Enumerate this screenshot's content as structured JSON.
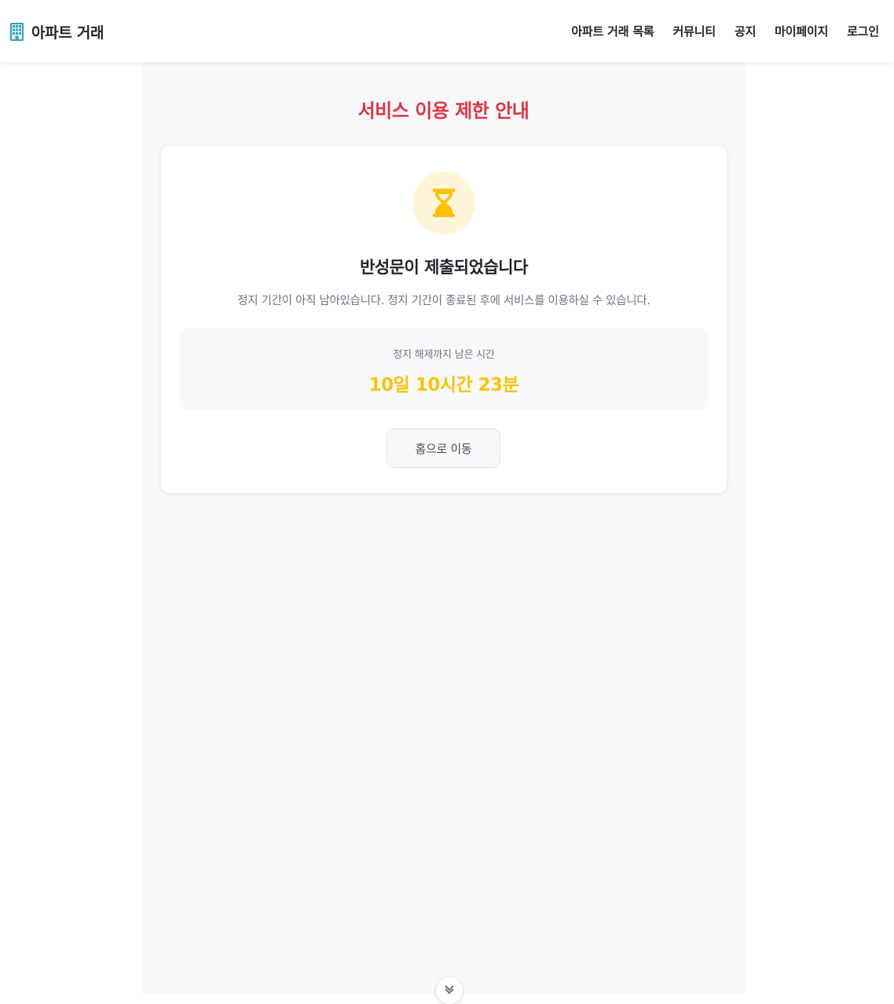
{
  "header": {
    "brand_icon": "office-building-icon",
    "brand_text": "아파트 거래",
    "nav_items": [
      {
        "label": "아파트 거래 목록"
      },
      {
        "label": "커뮤니티"
      },
      {
        "label": "공지"
      },
      {
        "label": "마이페이지"
      },
      {
        "label": "로그인"
      }
    ]
  },
  "main": {
    "title": "서비스 이용 제한 안내",
    "card": {
      "icon": "hourglass-icon",
      "heading": "반성문이 제출되었습니다",
      "description": "정지 기간이 아직 남아있습니다. 정지 기간이 종료된 후에 서비스를 이용하실 수 있습니다.",
      "remaining": {
        "label": "정지 해제까지 남은 시간",
        "value": "10일 10시간 23분"
      },
      "home_button_label": "홈으로 이동"
    },
    "scroll_icon": "chevron-down-icon"
  },
  "colors": {
    "title_red": "#dc3545",
    "accent_yellow": "#ffc107",
    "icon_bg": "#fff5d9",
    "page_bg": "#f7f8fa",
    "brand_icon_teal": "#17a2b8"
  }
}
